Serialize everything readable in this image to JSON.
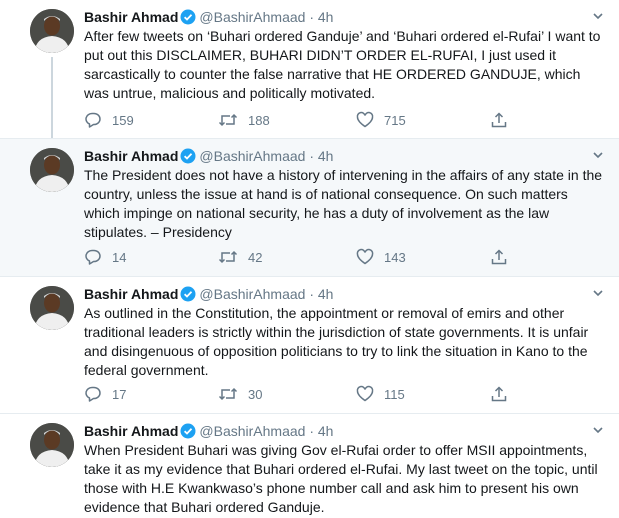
{
  "tweets": [
    {
      "name": "Bashir Ahmad",
      "handle": "@BashirAhmaad",
      "time": "4h",
      "text": "After few tweets on ‘Buhari ordered Ganduje’ and ‘Buhari ordered el-Rufai’ I want to put out this DISCLAIMER, BUHARI DIDN’T ORDER EL-RUFAI, I just used it sarcastically to counter the false narrative that HE ORDERED GANDUJE, which was untrue, malicious and politically motivated.",
      "replies": "159",
      "retweets": "188",
      "likes": "715"
    },
    {
      "name": "Bashir Ahmad",
      "handle": "@BashirAhmaad",
      "time": "4h",
      "text": "The President does not have a history of intervening in the affairs of any state in the country, unless the issue at hand is of national consequence. On such matters which impinge on national security, he has a duty of involvement as the law stipulates. – Presidency",
      "replies": "14",
      "retweets": "42",
      "likes": "143"
    },
    {
      "name": "Bashir Ahmad",
      "handle": "@BashirAhmaad",
      "time": "4h",
      "text": "As outlined in the Constitution, the appointment or removal of emirs and other traditional leaders is strictly within the jurisdiction of state governments. It is unfair and disingenuous of opposition politicians to try to link the situation in Kano to the federal government.",
      "replies": "17",
      "retweets": "30",
      "likes": "115"
    },
    {
      "name": "Bashir Ahmad",
      "handle": "@BashirAhmaad",
      "time": "4h",
      "text": "When President Buhari was giving Gov el-Rufai order to offer MSII appointments, take it as my evidence that Buhari ordered el-Rufai. My last tweet on the topic, until those with H.E Kwankwaso’s phone number call and ask him to present his own evidence that Buhari ordered Ganduje."
    }
  ],
  "separator": "·",
  "icons": [
    "verified-badge-icon",
    "chevron-down-icon",
    "reply-icon",
    "retweet-icon",
    "like-icon",
    "share-icon"
  ],
  "colors": {
    "verified": "#1da1f2",
    "secondary_text": "#657786",
    "highlight_bg": "#f5f8fa",
    "border": "#e6ecf0"
  }
}
